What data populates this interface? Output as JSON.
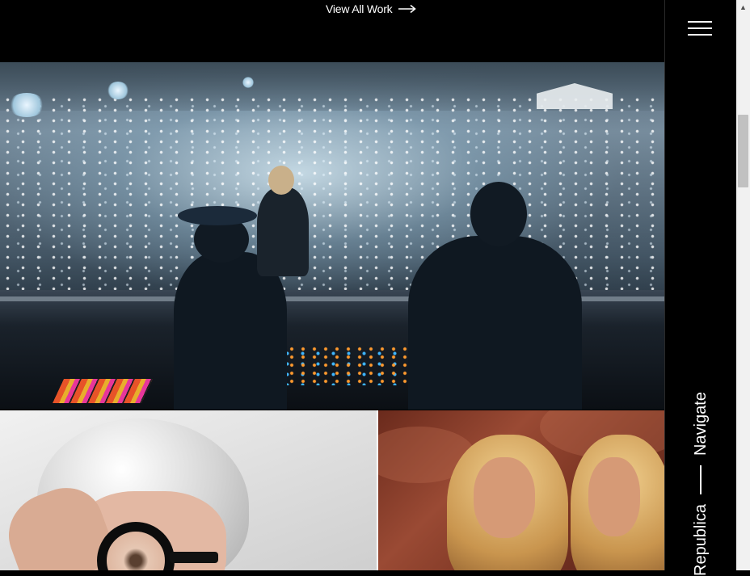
{
  "header": {
    "view_all_label": "View All Work",
    "arrow_icon": "long-right-arrow-icon"
  },
  "gallery": {
    "hero_image": "concert-dj-crowd-phone-lights",
    "left_tile_image": "silver-hair-woman-round-glasses",
    "right_tile_image": "two-blonde-women-red-rock"
  },
  "nav": {
    "menu_icon": "hamburger-menu-icon",
    "brand_text": "Republica",
    "navigate_label": "Navigate"
  },
  "scrollbar": {
    "up_arrow": "▲"
  },
  "colors": {
    "background": "#000000",
    "text": "#ffffff",
    "scroll_track": "#f1f1f1",
    "scroll_thumb": "#c1c1c1"
  }
}
